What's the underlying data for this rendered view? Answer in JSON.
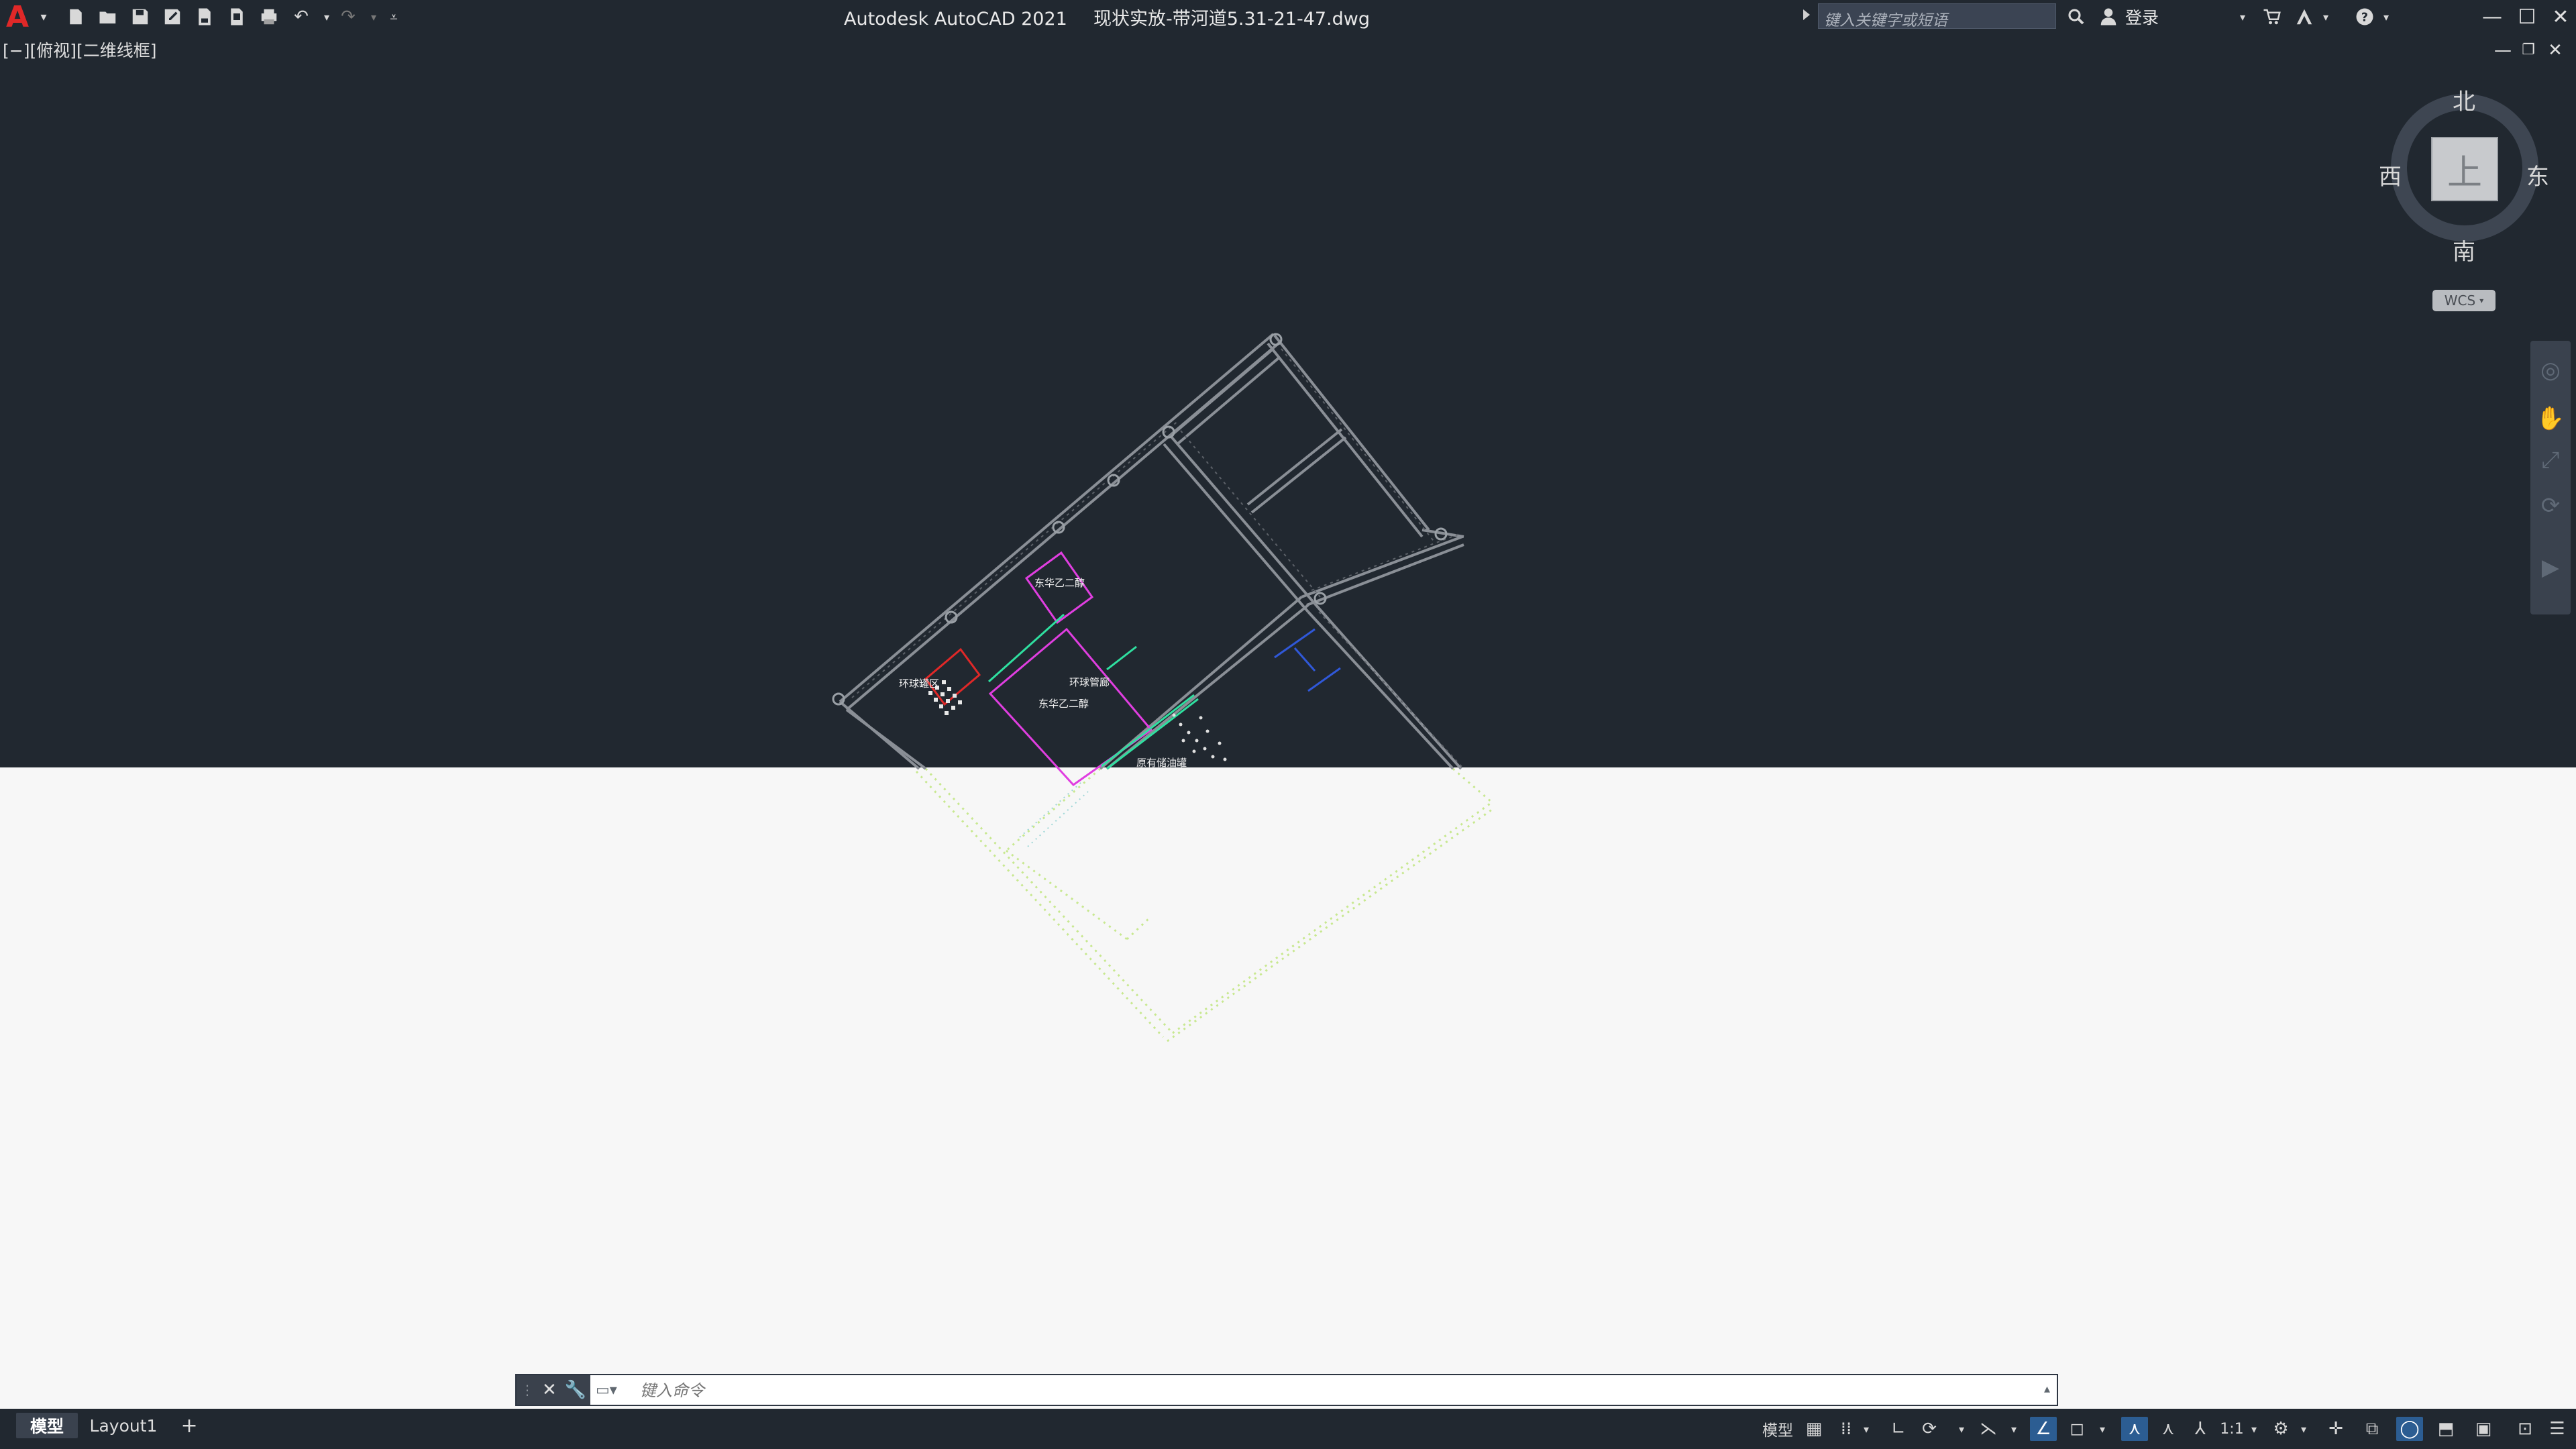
{
  "titlebar": {
    "app_name": "Autodesk AutoCAD 2021",
    "document": "现状实放-带河道5.31-21-47.dwg",
    "search_placeholder": "键入关键字或短语",
    "login_label": "登录",
    "app_logo": "A"
  },
  "viewport": {
    "label": "[−][俯视][二维线框]"
  },
  "drawing_labels": {
    "east_hua_2": "东华乙二醇",
    "east_hua_2b": "东华乙二醇",
    "ring_pipe": "环球管廊",
    "ring_storage": "环球罐区",
    "old_oil": "原有储油罐"
  },
  "viewcube": {
    "north": "北",
    "south": "南",
    "east": "东",
    "west": "西",
    "top_face": "上",
    "wcs_label": "WCS"
  },
  "command_line": {
    "placeholder": "键入命令"
  },
  "status_bar": {
    "tab_model": "模型",
    "tab_layout1": "Layout1",
    "tab_add": "+",
    "model_button": "模型",
    "scale_label": "1:1"
  },
  "colors": {
    "background": "#212830",
    "canvas_light": "#f7f7f7",
    "accent_blue": "#2c5d92",
    "logo_red": "#e02828"
  }
}
